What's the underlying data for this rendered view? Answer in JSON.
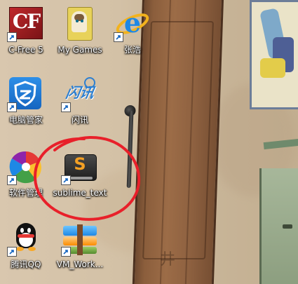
{
  "desktop": {
    "icons": [
      {
        "label": "C-Free 5",
        "icon": "c-free-icon"
      },
      {
        "label": "My Games",
        "icon": "my-games-icon"
      },
      {
        "label": "张浩",
        "icon": "internet-explorer-icon"
      },
      {
        "label": "电脑管家",
        "icon": "tencent-pc-manager-icon"
      },
      {
        "label": "闪讯",
        "icon": "shanxun-icon"
      },
      {
        "label": "软件管理",
        "icon": "software-manager-icon"
      },
      {
        "label": "sublime_text",
        "icon": "sublime-text-icon"
      },
      {
        "label": "腾讯QQ",
        "icon": "tencent-qq-icon"
      },
      {
        "label": "VM_Work...",
        "icon": "vmware-workstation-icon"
      }
    ],
    "icon_texts": {
      "cfree": "CF",
      "sublime": "S",
      "shanxun": "闪讯"
    },
    "annotation": {
      "shape": "hand-drawn circle",
      "color": "#e8202a",
      "target": "sublime_text"
    },
    "wallpaper_graffiti": "井",
    "colors": {
      "annotation": "#e8202a",
      "label_text": "#ffffff"
    }
  }
}
